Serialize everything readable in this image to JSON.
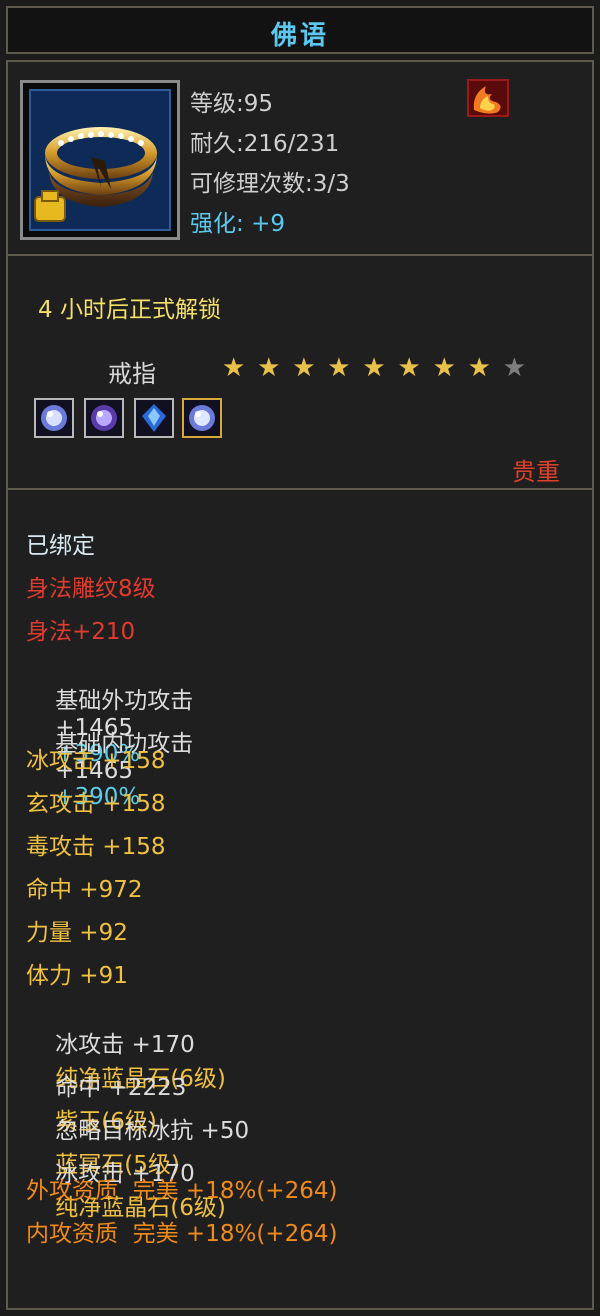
{
  "title": "佛语",
  "info": {
    "level_label": "等级:",
    "level_value": "95",
    "durability_label": "耐久:",
    "durability_value": "216/231",
    "repair_label": "可修理次数:",
    "repair_value": "3/3",
    "enhance_label": "强化:",
    "enhance_value": "+9"
  },
  "unlock_text": "4 小时后正式解锁",
  "item_type": "戒指",
  "stars": {
    "filled": 8,
    "total": 9
  },
  "rarity": "贵重",
  "stats": {
    "bound": "已绑定",
    "engrave": "身法雕纹8级",
    "agility": "身法+210",
    "ext_attack": {
      "label": "基础外功攻击",
      "value": "+1465",
      "pct": "+390%"
    },
    "int_attack": {
      "label": "基础内功攻击",
      "value": "+1465",
      "pct": "+390%"
    },
    "ice_attack": "冰攻击 +158",
    "xuan_attack": "玄攻击 +158",
    "poison_attack": "毒攻击 +158",
    "hit": "命中 +972",
    "strength": "力量 +92",
    "stamina": "体力 +91",
    "gem1": {
      "stat": "冰攻击 +170",
      "gem": "纯净蓝晶石(6级)"
    },
    "gem2": {
      "stat": "命中 +2223",
      "gem": "紫玉(6级)"
    },
    "gem3": {
      "stat": "忽略目标冰抗 +50",
      "gem": "蓝冥石(5级)"
    },
    "gem4": {
      "stat": "冰攻击 +170",
      "gem": "纯净蓝晶石(6级)"
    },
    "ext_quality": "外攻资质  完美 +18%(+264)",
    "int_quality": "内攻资质  完美 +18%(+264)"
  },
  "colors": {
    "title": "#5cc8f0",
    "rarity": "#e0402a",
    "red": "#e03b2e",
    "yellow": "#f0c040",
    "cyan": "#5ccbe8",
    "orange": "#f08a1a"
  },
  "icons": [
    "ring-item-icon",
    "fire-buff-icon",
    "gem-socket-icon",
    "star-icon"
  ]
}
